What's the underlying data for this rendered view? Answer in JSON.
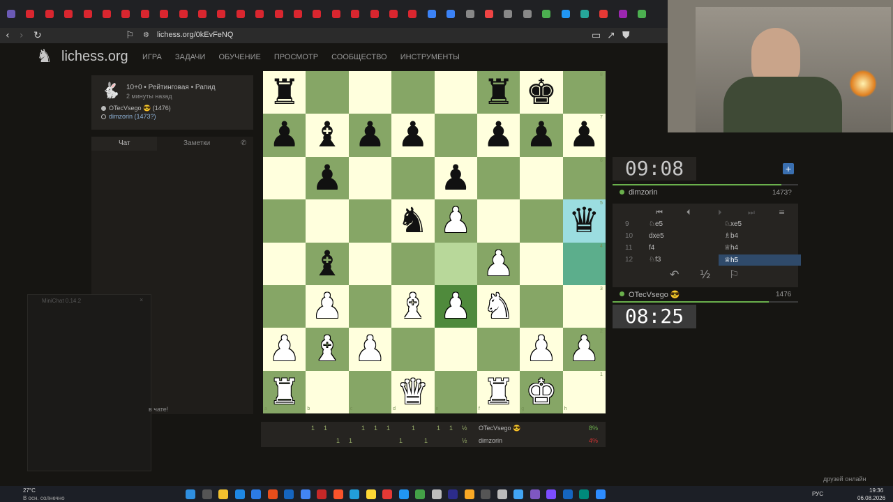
{
  "browser": {
    "url": "lichess.org/0kEvFeNQ"
  },
  "site": {
    "logo_text": "lichess.org",
    "nav": [
      "ИГРА",
      "ЗАДАЧИ",
      "ОБУЧЕНИЕ",
      "ПРОСМОТР",
      "СООБЩЕСТВО",
      "ИНСТРУМЕНТЫ"
    ]
  },
  "game_info": {
    "icon": "rabbit-icon",
    "line1": "10+0 • Рейтинговая • Рапид",
    "line2": "2 минуты назад",
    "white_player": "OTecVsego 😎 (1476)",
    "black_player": "dimzorin (1473?)"
  },
  "chat": {
    "tab_chat": "Чат",
    "tab_notes": "Заметки",
    "hint": "в чате!",
    "minichat_title": "MiniChat 0.14.2"
  },
  "board": {
    "orientation": "white",
    "light_color": "#ffffdd",
    "dark_color": "#86a666",
    "files": [
      "a",
      "b",
      "c",
      "d",
      "e",
      "f",
      "g",
      "h"
    ],
    "ranks": [
      "8",
      "7",
      "6",
      "5",
      "4",
      "3",
      "2",
      "1"
    ],
    "pieces": [
      {
        "sq": "a8",
        "p": "♜",
        "c": "b"
      },
      {
        "sq": "f8",
        "p": "♜",
        "c": "b"
      },
      {
        "sq": "g8",
        "p": "♚",
        "c": "b"
      },
      {
        "sq": "a7",
        "p": "♟",
        "c": "b"
      },
      {
        "sq": "b7",
        "p": "♝",
        "c": "b"
      },
      {
        "sq": "c7",
        "p": "♟",
        "c": "b"
      },
      {
        "sq": "d7",
        "p": "♟",
        "c": "b"
      },
      {
        "sq": "f7",
        "p": "♟",
        "c": "b"
      },
      {
        "sq": "g7",
        "p": "♟",
        "c": "b"
      },
      {
        "sq": "h7",
        "p": "♟",
        "c": "b"
      },
      {
        "sq": "b6",
        "p": "♟",
        "c": "b"
      },
      {
        "sq": "e6",
        "p": "♟",
        "c": "b"
      },
      {
        "sq": "d5",
        "p": "♞",
        "c": "b"
      },
      {
        "sq": "e5",
        "p": "♟",
        "c": "w"
      },
      {
        "sq": "h5",
        "p": "♛",
        "c": "b"
      },
      {
        "sq": "b4",
        "p": "♝",
        "c": "b"
      },
      {
        "sq": "f4",
        "p": "♟",
        "c": "w"
      },
      {
        "sq": "b3",
        "p": "♟",
        "c": "w"
      },
      {
        "sq": "d3",
        "p": "♝",
        "c": "w"
      },
      {
        "sq": "e3",
        "p": "♟",
        "c": "w"
      },
      {
        "sq": "f3",
        "p": "♞",
        "c": "w"
      },
      {
        "sq": "a2",
        "p": "♟",
        "c": "w"
      },
      {
        "sq": "b2",
        "p": "♝",
        "c": "w"
      },
      {
        "sq": "c2",
        "p": "♟",
        "c": "w"
      },
      {
        "sq": "g2",
        "p": "♟",
        "c": "w"
      },
      {
        "sq": "h2",
        "p": "♟",
        "c": "w"
      },
      {
        "sq": "a1",
        "p": "♜",
        "c": "w"
      },
      {
        "sq": "d1",
        "p": "♛",
        "c": "w"
      },
      {
        "sq": "f1",
        "p": "♜",
        "c": "w"
      },
      {
        "sq": "g1",
        "p": "♚",
        "c": "w"
      }
    ],
    "highlights": [
      {
        "sq": "h5",
        "color": "#9bdde0"
      },
      {
        "sq": "h4",
        "color": "#5cae8c"
      },
      {
        "sq": "e4",
        "color": "#b8d89a"
      },
      {
        "sq": "e3",
        "color": "#4f8a3c"
      }
    ]
  },
  "scores": {
    "white_name": "OTecVsego 😎",
    "black_name": "dimzorin",
    "white_pct": "8%",
    "black_pct": "4%",
    "white_points": [
      "1",
      "1",
      "",
      "",
      "1",
      "1",
      "1",
      "",
      "1",
      "",
      "1",
      "1",
      "½"
    ],
    "black_points": [
      "",
      "",
      "1",
      "1",
      "",
      "",
      "",
      "1",
      "",
      "1",
      "",
      "",
      "½"
    ]
  },
  "clocks": {
    "opponent_time": "09:08",
    "player_time": "08:25"
  },
  "right_panel": {
    "opponent_name": "dimzorin",
    "opponent_rating": "1473?",
    "player_name": "OTecVsego 😎",
    "player_rating": "1476",
    "draw_label": "½"
  },
  "moves": [
    {
      "n": "9",
      "w": "♘e5",
      "b": "♘xe5"
    },
    {
      "n": "10",
      "w": "dxe5",
      "b": "♗b4"
    },
    {
      "n": "11",
      "w": "f4",
      "b": "♕h4"
    },
    {
      "n": "12",
      "w": "♘f3",
      "b": "♕h5"
    }
  ],
  "taskbar": {
    "weather_temp": "27°C",
    "weather_desc": "В осн. солнечно",
    "lang": "РУС",
    "time": "19:36",
    "date": "06.08.2026",
    "friends": "друзей онлайн"
  }
}
